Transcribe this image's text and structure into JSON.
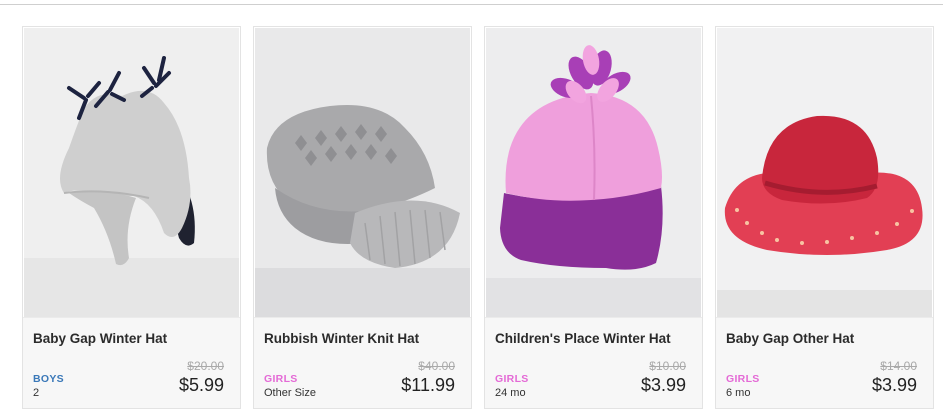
{
  "products": [
    {
      "title": "Baby Gap Winter Hat",
      "original_price": "$20.00",
      "category": "BOYS",
      "size": "2",
      "price": "$5.99",
      "image_icon": "gray-fleece-winter-hat-photo",
      "category_color": "#3a78b8"
    },
    {
      "title": "Rubbish Winter Knit Hat",
      "original_price": "$40.00",
      "category": "GIRLS",
      "size": "Other Size",
      "price": "$11.99",
      "image_icon": "gray-knit-cap-photo",
      "category_color": "#e46ad6"
    },
    {
      "title": "Children's Place Winter Hat",
      "original_price": "$10.00",
      "category": "GIRLS",
      "size": "24 mo",
      "price": "$3.99",
      "image_icon": "pink-purple-fleece-hat-photo",
      "category_color": "#e46ad6"
    },
    {
      "title": "Baby Gap Other Hat",
      "original_price": "$14.00",
      "category": "GIRLS",
      "size": "6 mo",
      "price": "$3.99",
      "image_icon": "red-bucket-hat-photo",
      "category_color": "#e46ad6"
    }
  ]
}
